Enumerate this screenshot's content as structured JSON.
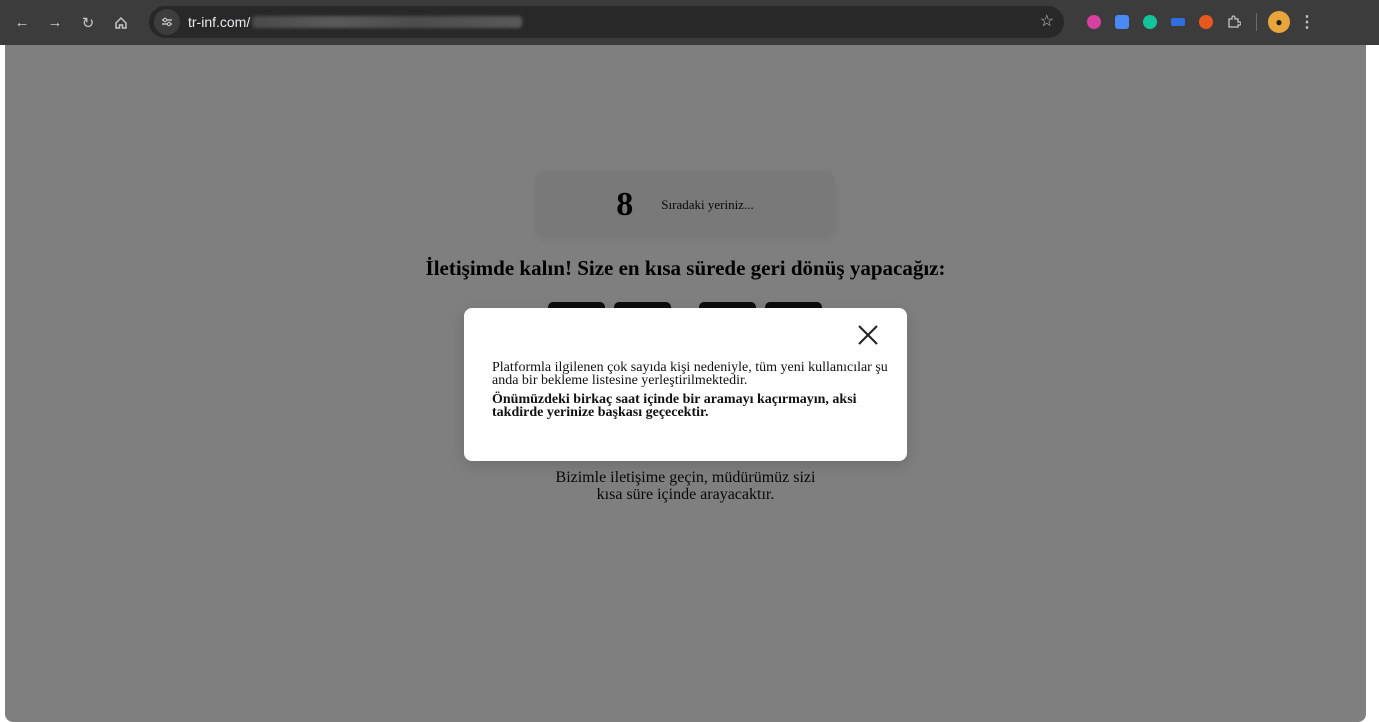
{
  "browser": {
    "url_visible": "tr-inf.com/",
    "extensions": [
      "blocker-icon",
      "translate-icon",
      "grammarly-icon",
      "extension-blue-icon",
      "extension-orange-icon",
      "puzzle-icon"
    ]
  },
  "queue": {
    "number": "8",
    "label": "Sıradaki yeriniz..."
  },
  "headline": "İletişimde kalın! Size en kısa sürede geri dönüş yapacağız:",
  "contact": {
    "line1": "Bizimle iletişime geçin, müdürümüz sizi",
    "line2": "kısa süre içinde arayacaktır."
  },
  "modal": {
    "paragraph": "Platformla ilgilenen çok sayıda kişi nedeniyle, tüm yeni kullanıcılar şu anda bir bekleme listesine yerleştirilmektedir.",
    "warning": "Önümüzdeki birkaç saat içinde bir aramayı kaçırmayın, aksi takdirde yerinize başkası geçecektir."
  },
  "colors": {
    "overlay": "rgba(0,0,0,0.5)",
    "chrome": "#3c3c3c"
  }
}
